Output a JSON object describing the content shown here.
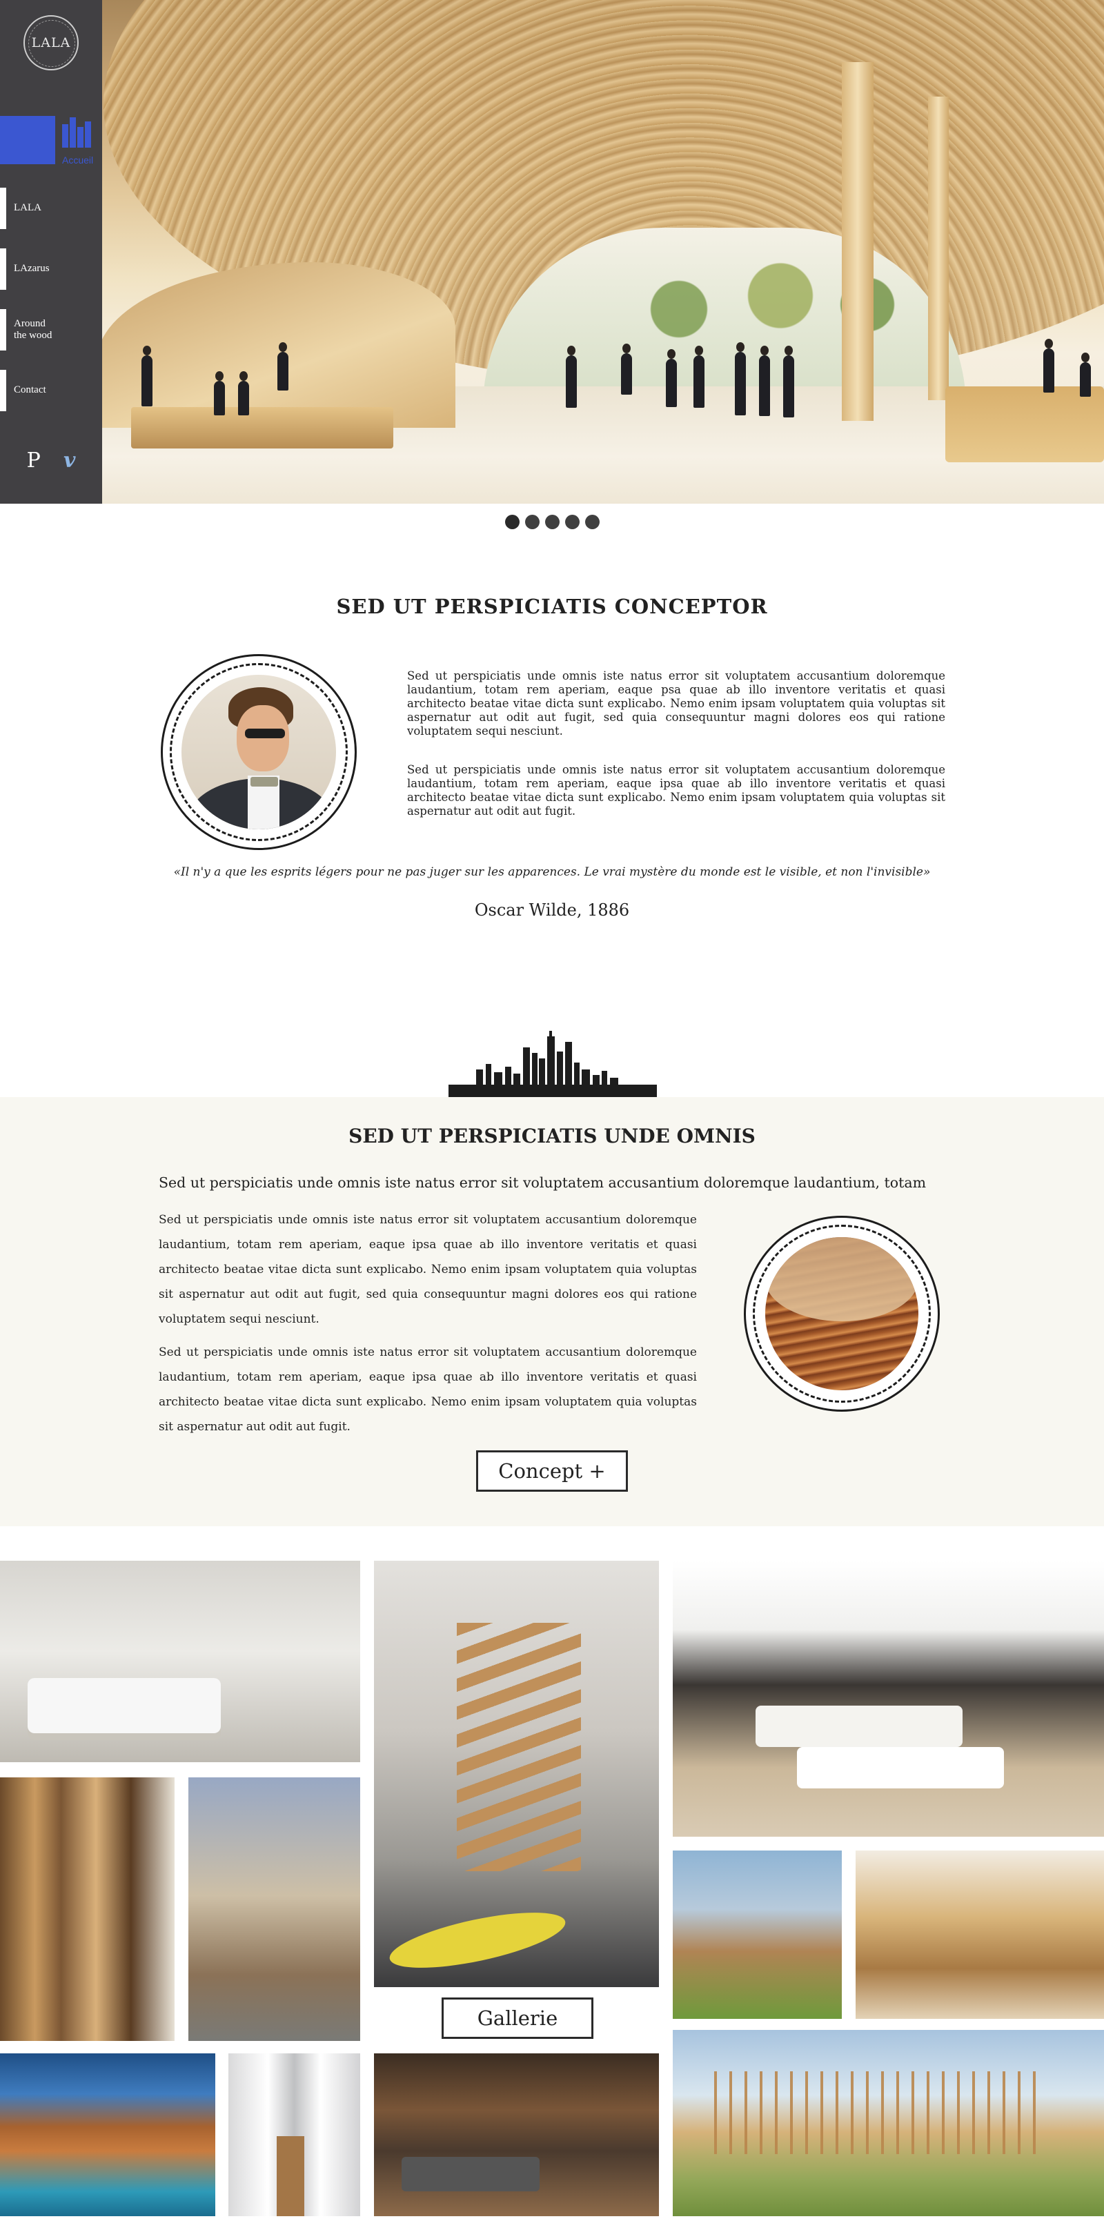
{
  "sidebar": {
    "logo_text": "LALA",
    "active_icon_label": "Accueil",
    "nav": [
      {
        "label": "LALA",
        "name": "sidebar-item-lala"
      },
      {
        "label": "LAzarus",
        "name": "sidebar-item-lazarus"
      },
      {
        "label": "Around\nthe wood",
        "name": "sidebar-item-around-the-wood"
      },
      {
        "label": "Contact",
        "name": "sidebar-item-contact"
      }
    ],
    "social": {
      "pinterest": "P",
      "vimeo": "v"
    }
  },
  "slider": {
    "dot_count": 5,
    "active_index": 0
  },
  "concept": {
    "title": "SED UT PERSPICIATIS CONCEPTOR",
    "para1": "Sed ut perspiciatis unde omnis iste natus error sit voluptatem accusantium doloremque laudantium, totam rem aperiam, eaque psa quae ab illo inventore veritatis et quasi architecto beatae vitae dicta sunt explicabo. Nemo enim ipsam voluptatem quia voluptas sit aspernatur aut odit aut fugit, sed quia consequuntur magni dolores eos qui ratione voluptatem sequi nesciunt.",
    "para2": "Sed ut perspiciatis unde omnis iste natus error sit voluptatem accusantium doloremque laudantium, totam rem aperiam, eaque ipsa quae ab illo inventore veritatis et quasi architecto beatae vitae dicta sunt explicabo. Nemo enim ipsam voluptatem quia voluptas sit aspernatur aut odit aut fugit.",
    "quote": "«Il n'y a que les esprits légers pour ne pas juger sur les apparences. Le vrai mystère du monde est le visible, et non l'invisible»",
    "quote_author": "Oscar Wilde, 1886"
  },
  "omnis": {
    "title": "SED UT PERSPICIATIS UNDE OMNIS",
    "lead": "Sed ut perspiciatis unde omnis iste natus error sit voluptatem accusantium doloremque laudantium, totam",
    "para1": "Sed ut perspiciatis unde omnis iste natus error sit voluptatem accusantium doloremque laudantium, totam rem aperiam, eaque ipsa quae ab illo inventore veritatis et quasi architecto beatae vitae dicta sunt explicabo. Nemo enim ipsam voluptatem quia voluptas sit aspernatur aut odit aut fugit, sed quia consequuntur magni dolores eos qui ratione voluptatem sequi nesciunt.",
    "para2": "Sed ut perspiciatis unde omnis iste natus error sit voluptatem accusantium doloremque laudantium, totam rem aperiam, eaque ipsa quae ab illo inventore veritatis et quasi architecto beatae vitae dicta sunt explicabo. Nemo enim ipsam voluptatem quia voluptas sit aspernatur aut odit aut fugit.",
    "button": "Concept +"
  },
  "gallery": {
    "button": "Gallerie"
  },
  "colors": {
    "sidebar_bg": "#414043",
    "accent": "#3b57d1",
    "section_bg": "#f8f7f1",
    "text": "#222222"
  }
}
